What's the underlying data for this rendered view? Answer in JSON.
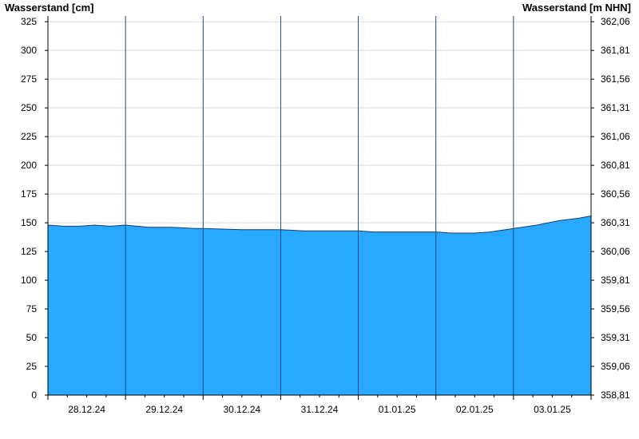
{
  "chart_data": {
    "type": "area",
    "left_axis_title": "Wasserstand [cm]",
    "right_axis_title": "Wasserstand [m NHN]",
    "ylim": [
      0,
      330
    ],
    "left_ticks": [
      0,
      25,
      50,
      75,
      100,
      125,
      150,
      175,
      200,
      225,
      250,
      275,
      300,
      325
    ],
    "right_ticks": [
      "358,81",
      "359,06",
      "359,31",
      "359,56",
      "359,81",
      "360,06",
      "360,31",
      "360,56",
      "360,81",
      "361,06",
      "361,31",
      "361,56",
      "361,81",
      "362,06"
    ],
    "x_labels": [
      "28.12.24",
      "29.12.24",
      "30.12.24",
      "31.12.24",
      "01.01.25",
      "02.01.25",
      "03.01.25"
    ],
    "x_range_days": [
      0,
      7
    ],
    "grid": true,
    "series": [
      {
        "color": "#29a8ff",
        "x": [
          0,
          0.2,
          0.4,
          0.6,
          0.8,
          1.0,
          1.3,
          1.6,
          1.9,
          2.0,
          2.5,
          3.0,
          3.3,
          3.7,
          4.0,
          4.2,
          4.6,
          5.0,
          5.2,
          5.5,
          5.7,
          6.0,
          6.3,
          6.6,
          6.85,
          7.0
        ],
        "y": [
          148,
          147,
          147,
          148,
          147,
          148,
          146,
          146,
          145,
          145,
          144,
          144,
          143,
          143,
          143,
          142,
          142,
          142,
          141,
          141,
          142,
          145,
          148,
          152,
          154,
          156
        ]
      }
    ]
  }
}
